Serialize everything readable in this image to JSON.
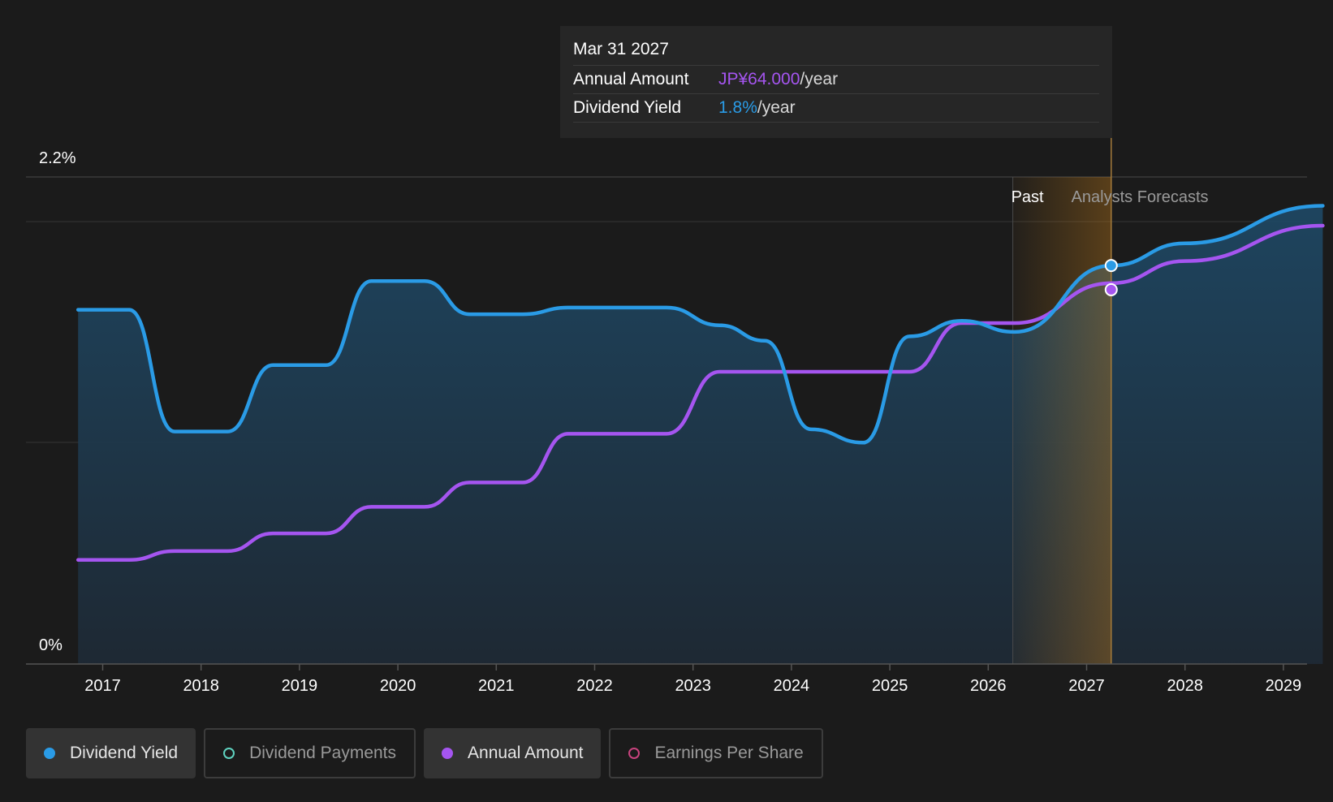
{
  "tooltip": {
    "date": "Mar 31 2027",
    "annual_amount_label": "Annual Amount",
    "annual_amount_value": "JP¥64.000",
    "dividend_yield_label": "Dividend Yield",
    "dividend_yield_value": "1.8%",
    "unit": "/year"
  },
  "regions": {
    "past_label": "Past",
    "forecast_label": "Analysts Forecasts"
  },
  "legend": [
    {
      "label": "Dividend Yield",
      "color": "#2a9be6",
      "active": true,
      "filled": true
    },
    {
      "label": "Dividend Payments",
      "color": "#5fd3c0",
      "active": false,
      "filled": false
    },
    {
      "label": "Annual Amount",
      "color": "#a555f0",
      "active": true,
      "filled": true
    },
    {
      "label": "Earnings Per Share",
      "color": "#c8437e",
      "active": false,
      "filled": false
    }
  ],
  "chart_data": {
    "type": "line",
    "y_axis": {
      "min_label": "0%",
      "max_label": "2.2%",
      "ylim": [
        0,
        2.2
      ]
    },
    "x_ticks": [
      "2017",
      "2018",
      "2019",
      "2020",
      "2021",
      "2022",
      "2023",
      "2024",
      "2025",
      "2026",
      "2027",
      "2028",
      "2029"
    ],
    "past_end": 2026.25,
    "forecast_marker": 2027.25,
    "colors": {
      "yield": "#2a9be6",
      "amount": "#a555f0",
      "highlight": "#c07a18"
    },
    "series": [
      {
        "name": "Dividend Yield",
        "unit": "%",
        "points": [
          [
            2016.75,
            1.6
          ],
          [
            2017.27,
            1.6
          ],
          [
            2017.73,
            1.05
          ],
          [
            2018.27,
            1.05
          ],
          [
            2018.73,
            1.35
          ],
          [
            2019.27,
            1.35
          ],
          [
            2019.73,
            1.73
          ],
          [
            2020.27,
            1.73
          ],
          [
            2020.73,
            1.58
          ],
          [
            2021.27,
            1.58
          ],
          [
            2021.73,
            1.61
          ],
          [
            2022.73,
            1.61
          ],
          [
            2023.27,
            1.53
          ],
          [
            2023.73,
            1.46
          ],
          [
            2024.2,
            1.06
          ],
          [
            2024.73,
            1.0
          ],
          [
            2025.2,
            1.48
          ],
          [
            2025.73,
            1.55
          ],
          [
            2026.27,
            1.5
          ],
          [
            2027.25,
            1.8
          ],
          [
            2028.0,
            1.9
          ],
          [
            2029.4,
            2.07
          ]
        ]
      },
      {
        "name": "Annual Amount",
        "unit": "JP¥",
        "points": [
          [
            2016.75,
            23.5
          ],
          [
            2017.27,
            23.5
          ],
          [
            2017.73,
            25.5
          ],
          [
            2018.27,
            25.5
          ],
          [
            2018.73,
            29.5
          ],
          [
            2019.27,
            29.5
          ],
          [
            2019.73,
            35.5
          ],
          [
            2020.27,
            35.5
          ],
          [
            2020.73,
            41
          ],
          [
            2021.27,
            41
          ],
          [
            2021.73,
            52
          ],
          [
            2022.73,
            52
          ],
          [
            2023.27,
            66
          ],
          [
            2025.2,
            66
          ],
          [
            2025.73,
            77
          ],
          [
            2026.27,
            77
          ],
          [
            2027.25,
            86
          ],
          [
            2028.0,
            91
          ],
          [
            2029.4,
            99
          ]
        ]
      }
    ]
  }
}
